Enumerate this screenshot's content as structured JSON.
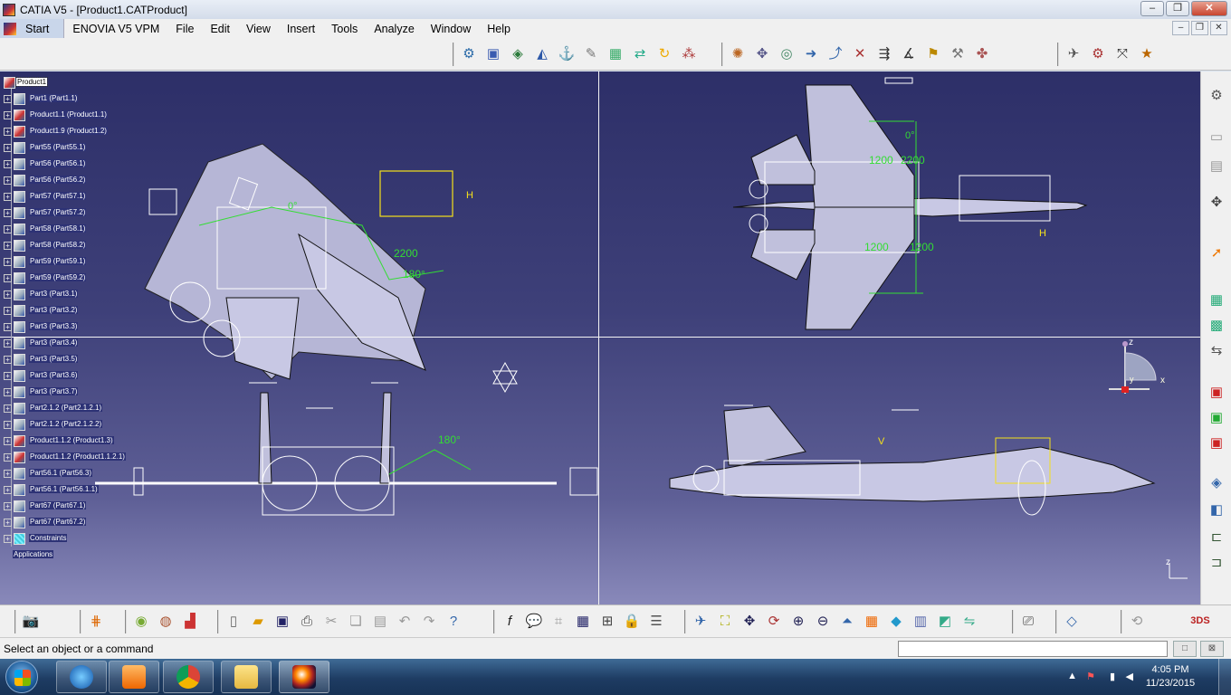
{
  "window": {
    "title": "CATIA V5 - [Product1.CATProduct]",
    "min": "–",
    "max": "❐",
    "close": "✕"
  },
  "menubar": {
    "start": "Start",
    "items": [
      "ENOVIA V5 VPM",
      "File",
      "Edit",
      "View",
      "Insert",
      "Tools",
      "Analyze",
      "Window",
      "Help"
    ],
    "mdi_min": "–",
    "mdi_restore": "❐",
    "mdi_close": "✕"
  },
  "tree": {
    "root": "Product1",
    "nodes": [
      {
        "label": "Part1 (Part1.1)",
        "kind": "part"
      },
      {
        "label": "Product1.1 (Product1.1)",
        "kind": "product"
      },
      {
        "label": "Product1.9 (Product1.2)",
        "kind": "product"
      },
      {
        "label": "Part55 (Part55.1)",
        "kind": "part"
      },
      {
        "label": "Part56 (Part56.1)",
        "kind": "part"
      },
      {
        "label": "Part56 (Part56.2)",
        "kind": "part"
      },
      {
        "label": "Part57 (Part57.1)",
        "kind": "part"
      },
      {
        "label": "Part57 (Part57.2)",
        "kind": "part"
      },
      {
        "label": "Part58 (Part58.1)",
        "kind": "part"
      },
      {
        "label": "Part58 (Part58.2)",
        "kind": "part"
      },
      {
        "label": "Part59 (Part59.1)",
        "kind": "part"
      },
      {
        "label": "Part59 (Part59.2)",
        "kind": "part"
      },
      {
        "label": "Part3 (Part3.1)",
        "kind": "part"
      },
      {
        "label": "Part3 (Part3.2)",
        "kind": "part"
      },
      {
        "label": "Part3 (Part3.3)",
        "kind": "part"
      },
      {
        "label": "Part3 (Part3.4)",
        "kind": "part"
      },
      {
        "label": "Part3 (Part3.5)",
        "kind": "part"
      },
      {
        "label": "Part3 (Part3.6)",
        "kind": "part"
      },
      {
        "label": "Part3 (Part3.7)",
        "kind": "part"
      },
      {
        "label": "Part2.1.2 (Part2.1.2.1)",
        "kind": "part"
      },
      {
        "label": "Part2.1.2 (Part2.1.2.2)",
        "kind": "part"
      },
      {
        "label": "Product1.1.2 (Product1.3)",
        "kind": "product"
      },
      {
        "label": "Product1.1.2 (Product1.1.2.1)",
        "kind": "product"
      },
      {
        "label": "Part56.1 (Part56.3)",
        "kind": "part"
      },
      {
        "label": "Part56.1 (Part56.1.1)",
        "kind": "part"
      },
      {
        "label": "Part67 (Part67.1)",
        "kind": "part"
      },
      {
        "label": "Part67 (Part67.2)",
        "kind": "part"
      },
      {
        "label": "Constraints",
        "kind": "constraints"
      }
    ],
    "applications": "Applications"
  },
  "viewport": {
    "dim_labels": {
      "a": "2200",
      "b": "180°",
      "c": "1200",
      "d": "0°",
      "e": "H",
      "f": "V"
    },
    "compass": {
      "z": "z",
      "x": "x",
      "y": "y"
    },
    "axis_z": "z"
  },
  "status": {
    "message": "Select an object or a command",
    "command_value": ""
  },
  "taskbar": {
    "time": "4:05 PM",
    "date": "11/23/2015",
    "apps": [
      "internet-explorer",
      "media-player",
      "chrome",
      "file-explorer",
      "catia"
    ]
  },
  "colors": {
    "viewport_top": "#2d2f68",
    "viewport_bottom": "#8989ba",
    "accent_green": "#33dd33",
    "accent_yellow": "#f5e11a"
  }
}
